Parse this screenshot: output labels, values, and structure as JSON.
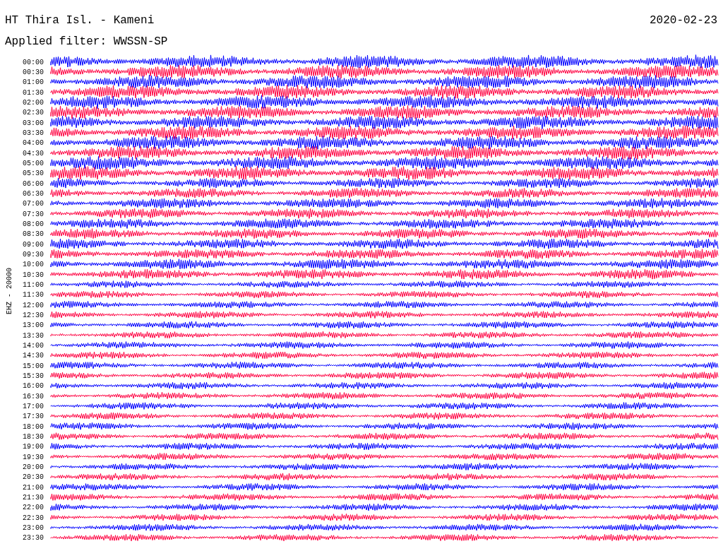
{
  "header": {
    "station": "HT Thira Isl. - Kameni",
    "date": "2020-02-23",
    "filter": "Applied filter: WWSSN-SP"
  },
  "plot": {
    "axis_label": "EHZ - 20000",
    "rows": [
      {
        "time": "00:00",
        "color": "#0000ff"
      },
      {
        "time": "00:30",
        "color": "#ff0040"
      },
      {
        "time": "01:00",
        "color": "#0000ff"
      },
      {
        "time": "01:30",
        "color": "#ff0040"
      },
      {
        "time": "02:00",
        "color": "#0000ff"
      },
      {
        "time": "02:30",
        "color": "#ff0040"
      },
      {
        "time": "03:00",
        "color": "#0000ff"
      },
      {
        "time": "03:30",
        "color": "#ff0040"
      },
      {
        "time": "04:00",
        "color": "#0000ff"
      },
      {
        "time": "04:30",
        "color": "#ff0040"
      },
      {
        "time": "05:00",
        "color": "#0000ff"
      },
      {
        "time": "05:30",
        "color": "#ff0040"
      },
      {
        "time": "06:00",
        "color": "#0000ff"
      },
      {
        "time": "06:30",
        "color": "#ff0040"
      },
      {
        "time": "07:00",
        "color": "#0000ff"
      },
      {
        "time": "07:30",
        "color": "#ff0040"
      },
      {
        "time": "08:00",
        "color": "#0000ff"
      },
      {
        "time": "08:30",
        "color": "#ff0040"
      },
      {
        "time": "09:00",
        "color": "#0000ff"
      },
      {
        "time": "09:30",
        "color": "#ff0040"
      },
      {
        "time": "10:00",
        "color": "#0000ff"
      },
      {
        "time": "10:30",
        "color": "#ff0040"
      },
      {
        "time": "11:00",
        "color": "#0000ff"
      },
      {
        "time": "11:30",
        "color": "#ff0040"
      },
      {
        "time": "12:00",
        "color": "#0000ff"
      },
      {
        "time": "12:30",
        "color": "#ff0040"
      },
      {
        "time": "13:00",
        "color": "#0000ff"
      },
      {
        "time": "13:30",
        "color": "#ff0040"
      },
      {
        "time": "14:00",
        "color": "#0000ff"
      },
      {
        "time": "14:30",
        "color": "#ff0040"
      },
      {
        "time": "15:00",
        "color": "#0000ff"
      },
      {
        "time": "15:30",
        "color": "#ff0040"
      },
      {
        "time": "16:00",
        "color": "#0000ff"
      },
      {
        "time": "16:30",
        "color": "#ff0040"
      },
      {
        "time": "17:00",
        "color": "#0000ff"
      },
      {
        "time": "17:30",
        "color": "#ff0040"
      },
      {
        "time": "18:00",
        "color": "#0000ff"
      },
      {
        "time": "18:30",
        "color": "#ff0040"
      },
      {
        "time": "19:00",
        "color": "#0000ff"
      },
      {
        "time": "19:30",
        "color": "#ff0040"
      },
      {
        "time": "20:00",
        "color": "#0000ff"
      },
      {
        "time": "20:30",
        "color": "#ff0040"
      },
      {
        "time": "21:00",
        "color": "#0000ff"
      },
      {
        "time": "21:30",
        "color": "#ff0040"
      },
      {
        "time": "22:00",
        "color": "#0000ff"
      },
      {
        "time": "22:30",
        "color": "#ff0040"
      },
      {
        "time": "23:00",
        "color": "#0000ff"
      },
      {
        "time": "23:30",
        "color": "#ff0040"
      }
    ]
  }
}
